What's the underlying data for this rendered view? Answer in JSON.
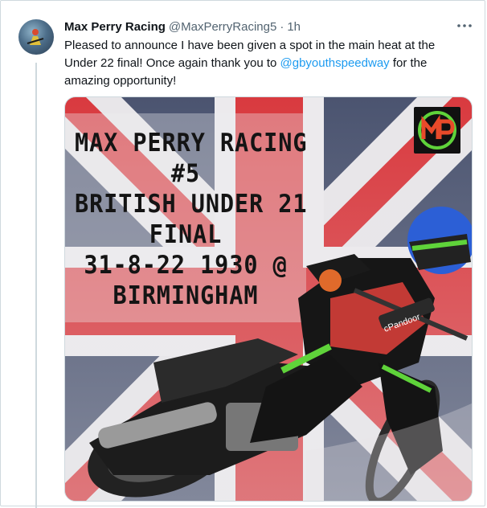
{
  "tweet": {
    "author_name": "Max Perry Racing",
    "handle": "@MaxPerryRacing5",
    "separator": "·",
    "time": "1h",
    "text_before": "Pleased to announce I have been given a spot in the main heat at the Under 22 final! Once again thank you to ",
    "mention": "@gbyouthspeedway",
    "text_after": " for the amazing opportunity!",
    "more_icon": "ellipsis-icon"
  },
  "poster": {
    "lines": [
      "MAX PERRY RACING",
      "#5",
      "BRITISH UNDER 21",
      "FINAL",
      "31-8-22 1930 @",
      "BIRMINGHAM"
    ],
    "logo_text": "MP",
    "rider_sponsor": "cPandoor"
  },
  "colors": {
    "mention": "#1d9bf0",
    "secondary_text": "#536471",
    "union_jack_red": "#d93a3f",
    "union_jack_blue": "#4b5470",
    "logo_green": "#5fd33a"
  }
}
